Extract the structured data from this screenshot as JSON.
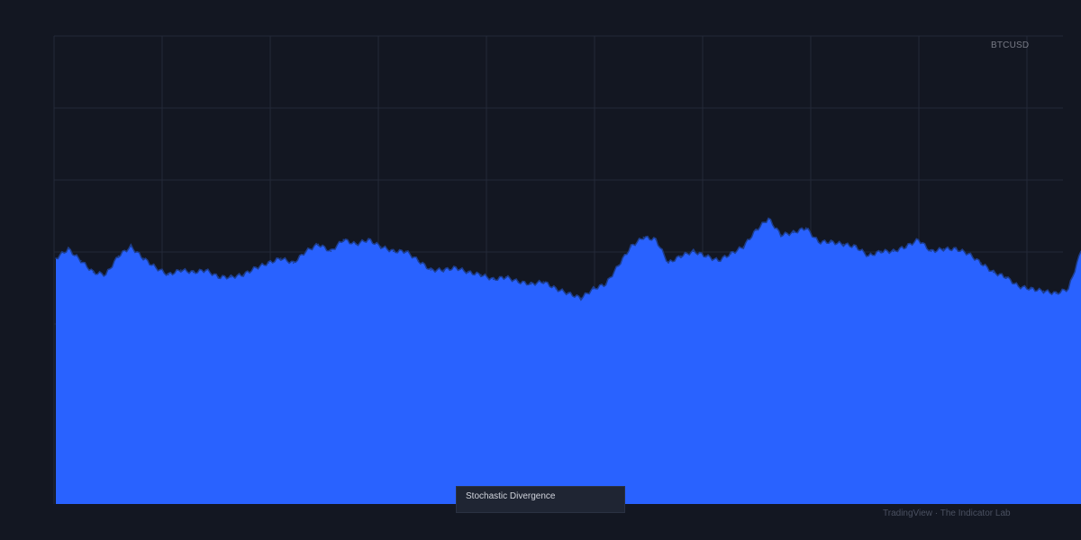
{
  "symbol": "BTCUSD",
  "indicator_name": "Stochastic Divergence",
  "attribution": "TradingView · The Indicator Lab",
  "colors": {
    "background": "#131722",
    "grid": "#232838",
    "area_fill": "#2962ff",
    "area_line": "#1e3f8f",
    "label": "#787b86"
  },
  "chart_data": {
    "type": "area",
    "title": "",
    "xlabel": "",
    "ylabel": "",
    "ylim": [
      0,
      100
    ],
    "grid": true,
    "series": [
      {
        "values": [
          52.5,
          54.5,
          52.0,
          49.5,
          49.0,
          53.0,
          55.0,
          52.5,
          50.5,
          49.0,
          50.0,
          49.5,
          50.0,
          48.5,
          48.5,
          49.0,
          50.5,
          51.5,
          52.5,
          51.5,
          54.0,
          55.5,
          54.0,
          56.5,
          55.5,
          56.5,
          55.0,
          54.0,
          54.0,
          52.0,
          50.0,
          50.0,
          50.5,
          49.5,
          49.0,
          48.0,
          48.5,
          47.5,
          47.0,
          47.5,
          46.0,
          45.0,
          44.0,
          46.0,
          47.0,
          51.0,
          55.0,
          57.0,
          56.5,
          51.5,
          53.0,
          54.0,
          53.0,
          52.0,
          53.5,
          55.0,
          58.5,
          61.0,
          57.5,
          58.0,
          59.0,
          56.0,
          56.0,
          55.5,
          55.0,
          53.0,
          54.0,
          54.0,
          55.0,
          56.5,
          54.0,
          54.5,
          54.5,
          53.5,
          51.5,
          49.5,
          48.5,
          46.5,
          46.0,
          45.5,
          45.0,
          46.0,
          54.0
        ]
      }
    ]
  }
}
